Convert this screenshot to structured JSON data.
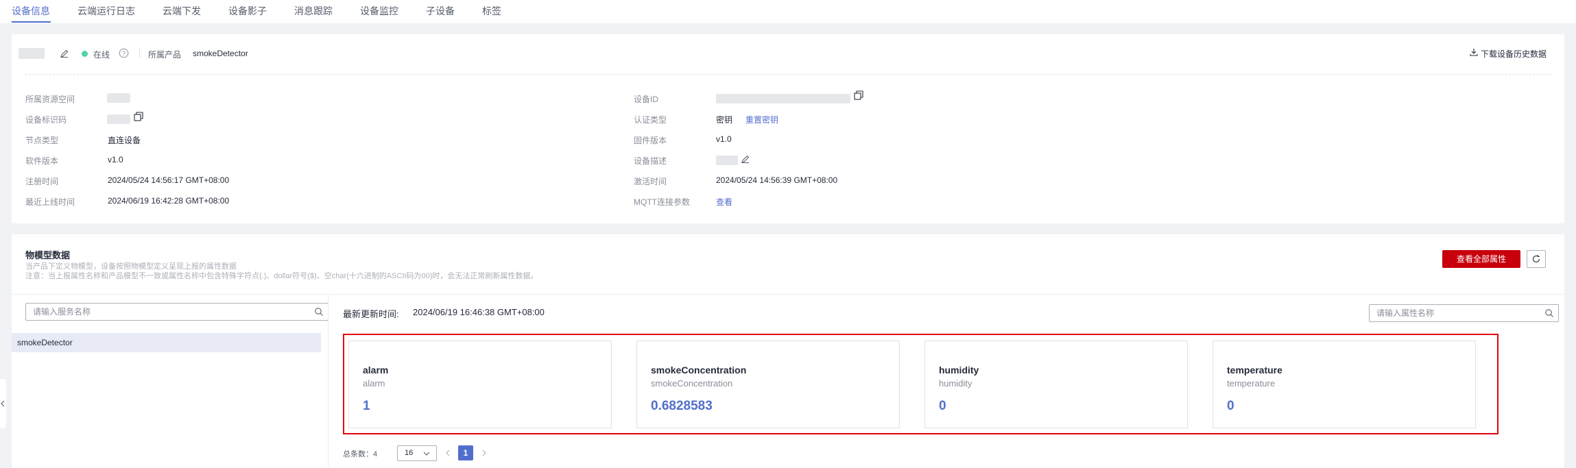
{
  "tabs": [
    "设备信息",
    "云端运行日志",
    "云端下发",
    "设备影子",
    "消息跟踪",
    "设备监控",
    "子设备",
    "标签"
  ],
  "header": {
    "status": "在线",
    "product_label": "所属产品",
    "product_value": "smokeDetector",
    "download_label": "下载设备历史数据"
  },
  "info_left": [
    {
      "label": "所属资源空间",
      "value": ""
    },
    {
      "label": "设备标识码",
      "value": ""
    },
    {
      "label": "节点类型",
      "value": "直连设备"
    },
    {
      "label": "软件版本",
      "value": "v1.0"
    },
    {
      "label": "注册时间",
      "value": "2024/05/24 14:56:17 GMT+08:00"
    },
    {
      "label": "最近上线时间",
      "value": "2024/06/19 16:42:28 GMT+08:00"
    }
  ],
  "info_right": [
    {
      "label": "设备ID",
      "value": ""
    },
    {
      "label": "认证类型",
      "value": "密钥",
      "link": "重置密钥"
    },
    {
      "label": "固件版本",
      "value": "v1.0"
    },
    {
      "label": "设备描述",
      "value": ""
    },
    {
      "label": "激活时间",
      "value": "2024/05/24 14:56:39 GMT+08:00"
    },
    {
      "label": "MQTT连接参数",
      "value": "",
      "link": "查看"
    }
  ],
  "model": {
    "title": "物模型数据",
    "desc1": "当产品下定义物模型，设备按照物模型定义呈现上报的属性数据",
    "desc2": "注意：当上报属性名称和产品模型不一致或属性名称中包含特殊字符点(.)、dollar符号($)、空char(十六进制的ASCII码为00)时，会无法正常刷新属性数据。",
    "view_all": "查看全部属性",
    "service_placeholder": "请输入服务名称",
    "service_item": "smokeDetector",
    "update_label": "最新更新时间:",
    "update_time": "2024/06/19 16:46:38 GMT+08:00",
    "prop_placeholder": "请输入属性名称"
  },
  "properties": [
    {
      "name": "alarm",
      "id": "alarm",
      "value": "1"
    },
    {
      "name": "smokeConcentration",
      "id": "smokeConcentration",
      "value": "0.6828583"
    },
    {
      "name": "humidity",
      "id": "humidity",
      "value": "0"
    },
    {
      "name": "temperature",
      "id": "temperature",
      "value": "0"
    }
  ],
  "pagination": {
    "total_label": "总条数：4",
    "page_size": "16",
    "current_page": "1"
  },
  "colors": {
    "accent": "#526ecc",
    "primary_button": "#c7000b",
    "status_online": "#50d4ab",
    "highlight_box": "#e3000b"
  },
  "icons": [
    "edit-icon",
    "help-icon",
    "download-icon",
    "copy-icon",
    "search-icon",
    "refresh-icon",
    "chevron-down-icon",
    "chevron-left-icon",
    "chevron-right-icon"
  ]
}
